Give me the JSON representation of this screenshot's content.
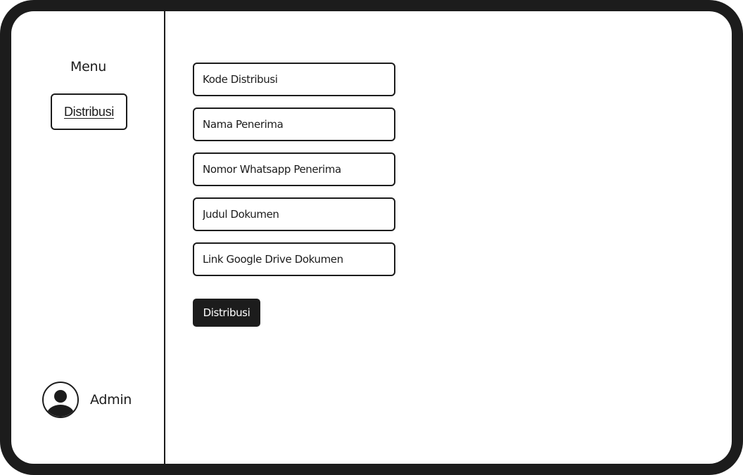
{
  "sidebar": {
    "menu_title": "Menu",
    "nav_item": "Distribusi",
    "user": {
      "name": "Admin",
      "icon": "user-avatar-icon"
    }
  },
  "form": {
    "fields": [
      {
        "placeholder": "Kode Distribusi",
        "value": ""
      },
      {
        "placeholder": "Nama Penerima",
        "value": ""
      },
      {
        "placeholder": "Nomor Whatsapp Penerima",
        "value": ""
      },
      {
        "placeholder": "Judul Dokumen",
        "value": ""
      },
      {
        "placeholder": "Link Google Drive Dokumen",
        "value": ""
      }
    ],
    "submit_label": "Distribusi"
  },
  "colors": {
    "frame": "#1c1c1c",
    "background": "#ffffff",
    "button": "#1c1c1c",
    "button_text": "#ffffff"
  }
}
